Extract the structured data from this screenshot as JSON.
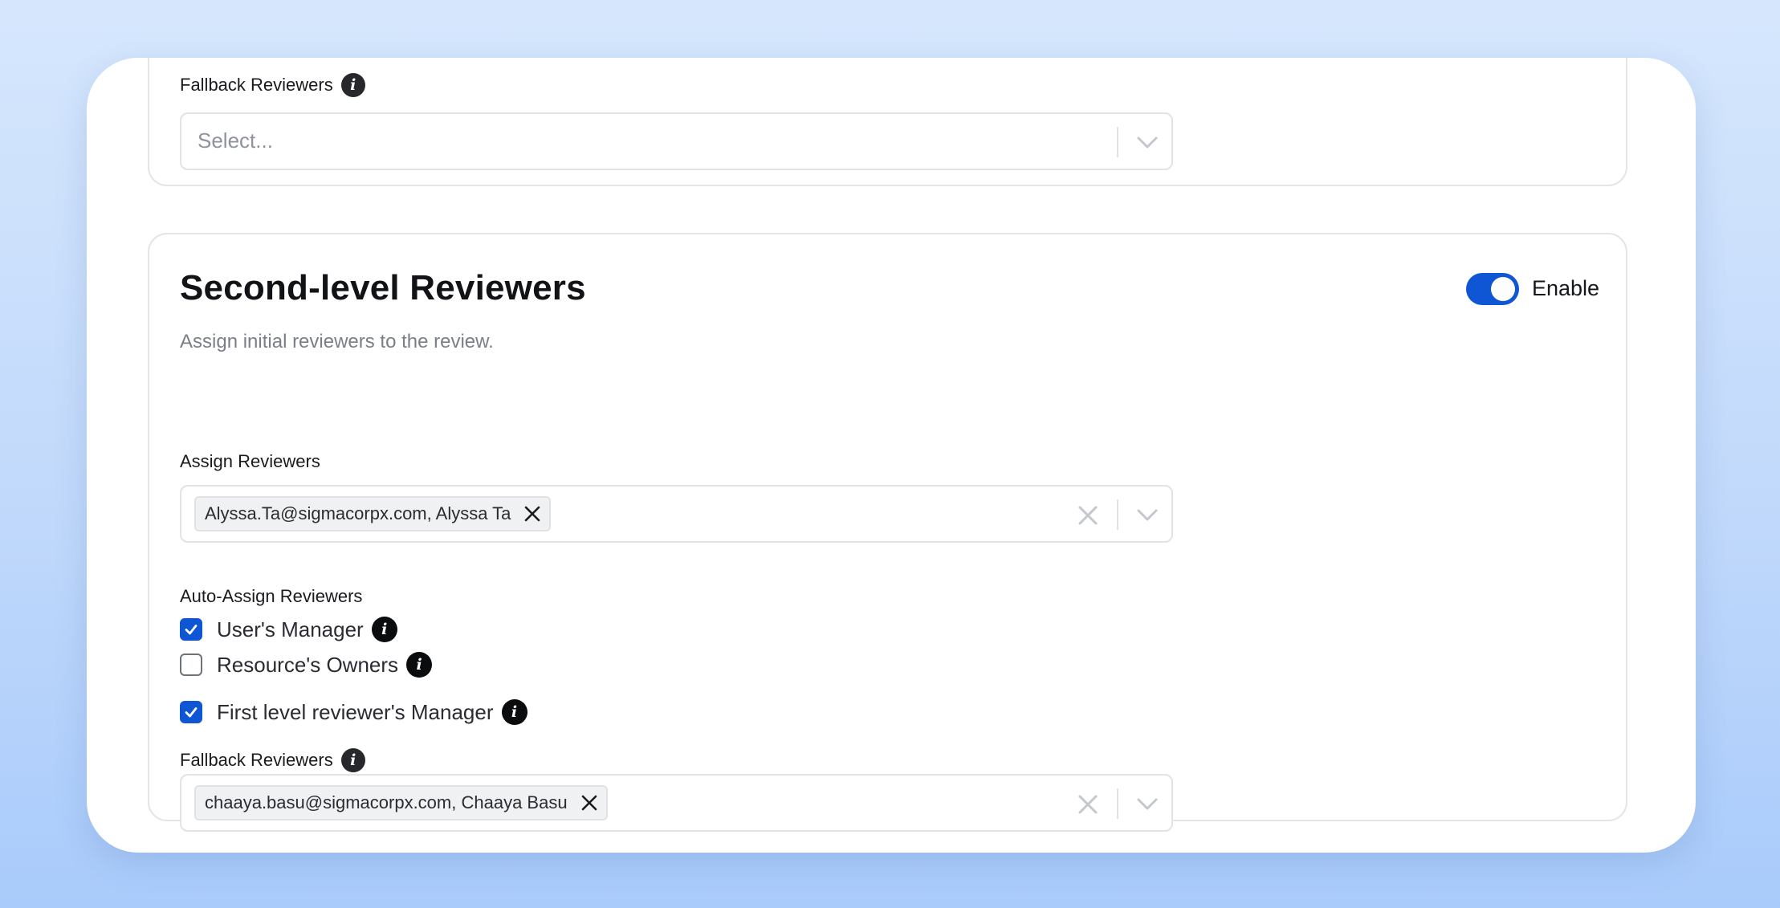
{
  "top_section": {
    "fallback_label": "Fallback Reviewers",
    "fallback_placeholder": "Select..."
  },
  "second_level": {
    "title": "Second-level Reviewers",
    "subtitle": "Assign initial reviewers to the review.",
    "enable_label": "Enable",
    "enabled": true,
    "assign_label": "Assign Reviewers",
    "assign_chip": "Alyssa.Ta@sigmacorpx.com, Alyssa Ta",
    "auto_assign_label": "Auto-Assign Reviewers",
    "options": [
      {
        "label": "User's Manager",
        "checked": true
      },
      {
        "label": "Resource's Owners",
        "checked": false
      },
      {
        "label": "First level reviewer's Manager",
        "checked": true
      }
    ],
    "fallback_label": "Fallback Reviewers",
    "fallback_chip": "chaaya.basu@sigmacorpx.com, Chaaya Basu"
  },
  "colors": {
    "accent": "#0f56d4",
    "info_icon": "#26282c"
  },
  "icons": {
    "info": "info-icon",
    "chevron": "chevron-down-icon",
    "clear": "close-icon",
    "check": "checkmark-icon"
  }
}
